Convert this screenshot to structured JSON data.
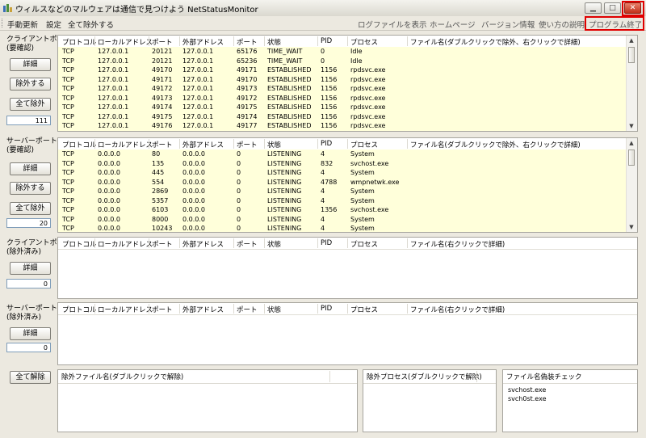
{
  "window": {
    "title": "ウィルスなどのマルウェアは通信で見つけよう NetStatusMonitor",
    "minimize_glyph": "▁",
    "maximize_glyph": "□",
    "close_glyph": "✕"
  },
  "menu": {
    "left": [
      "手動更新",
      "設定",
      "全て除外する"
    ],
    "right": [
      "ログファイルを表示",
      "ホームページ",
      "バージョン情報",
      "使い方の説明",
      "プログラム終了"
    ]
  },
  "columns": [
    "プロトコル",
    "ローカルアドレス",
    "ポート",
    "外部アドレス",
    "ポート",
    "状態",
    "PID",
    "プロセス"
  ],
  "sections": {
    "client_check": {
      "label": "クライアントポート\n(要確認)",
      "detail_button": "詳細",
      "exclude_button": "除外する",
      "exclude_all_button": "全て除外",
      "count": "111",
      "file_column": "ファイル名(ダブルクリックで除外、右クリックで詳細)",
      "rows": [
        [
          "TCP",
          "127.0.0.1",
          "20121",
          "127.0.0.1",
          "65176",
          "TIME_WAIT",
          "0",
          "Idle"
        ],
        [
          "TCP",
          "127.0.0.1",
          "20121",
          "127.0.0.1",
          "65236",
          "TIME_WAIT",
          "0",
          "Idle"
        ],
        [
          "TCP",
          "127.0.0.1",
          "49170",
          "127.0.0.1",
          "49171",
          "ESTABLISHED",
          "1156",
          "rpdsvc.exe"
        ],
        [
          "TCP",
          "127.0.0.1",
          "49171",
          "127.0.0.1",
          "49170",
          "ESTABLISHED",
          "1156",
          "rpdsvc.exe"
        ],
        [
          "TCP",
          "127.0.0.1",
          "49172",
          "127.0.0.1",
          "49173",
          "ESTABLISHED",
          "1156",
          "rpdsvc.exe"
        ],
        [
          "TCP",
          "127.0.0.1",
          "49173",
          "127.0.0.1",
          "49172",
          "ESTABLISHED",
          "1156",
          "rpdsvc.exe"
        ],
        [
          "TCP",
          "127.0.0.1",
          "49174",
          "127.0.0.1",
          "49175",
          "ESTABLISHED",
          "1156",
          "rpdsvc.exe"
        ],
        [
          "TCP",
          "127.0.0.1",
          "49175",
          "127.0.0.1",
          "49174",
          "ESTABLISHED",
          "1156",
          "rpdsvc.exe"
        ],
        [
          "TCP",
          "127.0.0.1",
          "49176",
          "127.0.0.1",
          "49177",
          "ESTABLISHED",
          "1156",
          "rpdsvc.exe"
        ]
      ]
    },
    "server_check": {
      "label": "サーバーポート\n(要確認)",
      "detail_button": "詳細",
      "exclude_button": "除外する",
      "exclude_all_button": "全て除外",
      "count": "20",
      "file_column": "ファイル名(ダブルクリックで除外、右クリックで詳細)",
      "rows": [
        [
          "TCP",
          "0.0.0.0",
          "80",
          "0.0.0.0",
          "0",
          "LISTENING",
          "4",
          "System"
        ],
        [
          "TCP",
          "0.0.0.0",
          "135",
          "0.0.0.0",
          "0",
          "LISTENING",
          "832",
          "svchost.exe"
        ],
        [
          "TCP",
          "0.0.0.0",
          "445",
          "0.0.0.0",
          "0",
          "LISTENING",
          "4",
          "System"
        ],
        [
          "TCP",
          "0.0.0.0",
          "554",
          "0.0.0.0",
          "0",
          "LISTENING",
          "4788",
          "wmpnetwk.exe"
        ],
        [
          "TCP",
          "0.0.0.0",
          "2869",
          "0.0.0.0",
          "0",
          "LISTENING",
          "4",
          "System"
        ],
        [
          "TCP",
          "0.0.0.0",
          "5357",
          "0.0.0.0",
          "0",
          "LISTENING",
          "4",
          "System"
        ],
        [
          "TCP",
          "0.0.0.0",
          "6103",
          "0.0.0.0",
          "0",
          "LISTENING",
          "1356",
          "svchost.exe"
        ],
        [
          "TCP",
          "0.0.0.0",
          "8000",
          "0.0.0.0",
          "0",
          "LISTENING",
          "4",
          "System"
        ],
        [
          "TCP",
          "0.0.0.0",
          "10243",
          "0.0.0.0",
          "0",
          "LISTENING",
          "4",
          "System"
        ]
      ]
    },
    "client_excluded": {
      "label": "クライアントポート\n(除外済み)",
      "detail_button": "詳細",
      "count": "0",
      "file_column": "ファイル名(右クリックで詳細)"
    },
    "server_excluded": {
      "label": "サーバーポート\n(除外済み)",
      "detail_button": "詳細",
      "count": "0",
      "file_column": "ファイル名(右クリックで詳細)"
    }
  },
  "bottom": {
    "release_all_button": "全て解除",
    "excluded_files_title": "除外ファイル名(ダブルクリックで解除)",
    "excluded_process_title": "除外プロセス(ダブルクリックで解除)",
    "disguise_check_title": "ファイル名偽装チェック",
    "disguise_items": [
      "svchost.exe",
      "svch0st.exe"
    ]
  },
  "colors": {
    "row_highlight": "#FFFFDA",
    "close_highlight": "#E00000"
  }
}
